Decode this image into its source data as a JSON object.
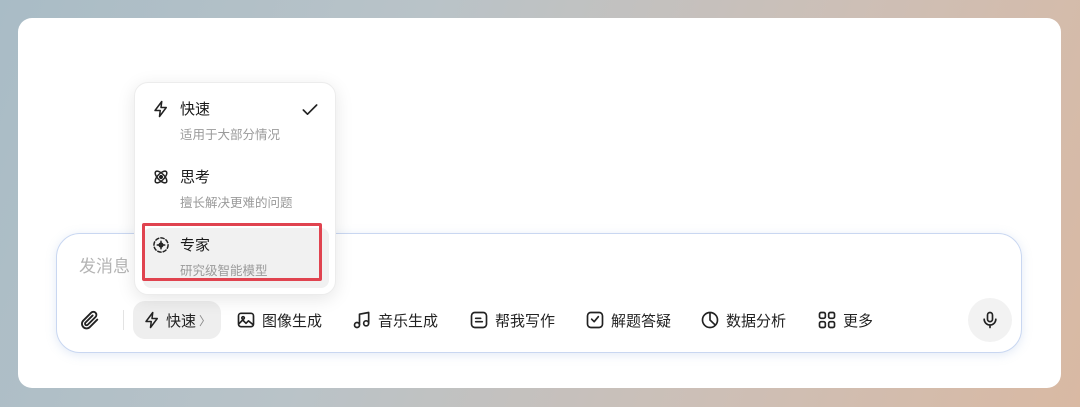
{
  "input": {
    "placeholder": "发消息"
  },
  "toolbar": {
    "attach_icon": "paperclip-icon",
    "mode": {
      "label": "快速",
      "chevron": "〉",
      "icon": "lightning-icon"
    },
    "tools": [
      {
        "label": "图像生成",
        "icon": "image-icon"
      },
      {
        "label": "音乐生成",
        "icon": "music-note-icon"
      },
      {
        "label": "帮我写作",
        "icon": "writing-icon"
      },
      {
        "label": "解题答疑",
        "icon": "check-square-icon"
      },
      {
        "label": "数据分析",
        "icon": "pie-chart-icon"
      },
      {
        "label": "更多",
        "icon": "grid-icon"
      }
    ],
    "mic_icon": "microphone-icon"
  },
  "mode_menu": {
    "options": [
      {
        "title": "快速",
        "desc": "适用于大部分情况",
        "icon": "lightning-icon",
        "selected": true
      },
      {
        "title": "思考",
        "desc": "擅长解决更难的问题",
        "icon": "atom-icon",
        "selected": false
      },
      {
        "title": "专家",
        "desc": "研究级智能模型",
        "icon": "expert-icon",
        "selected": false,
        "hovered": true
      }
    ]
  },
  "colors": {
    "highlight_border": "#e0434f",
    "input_border": "#c9d7f1",
    "text_primary": "#1a1a1a",
    "text_secondary": "#9a9a9a"
  }
}
